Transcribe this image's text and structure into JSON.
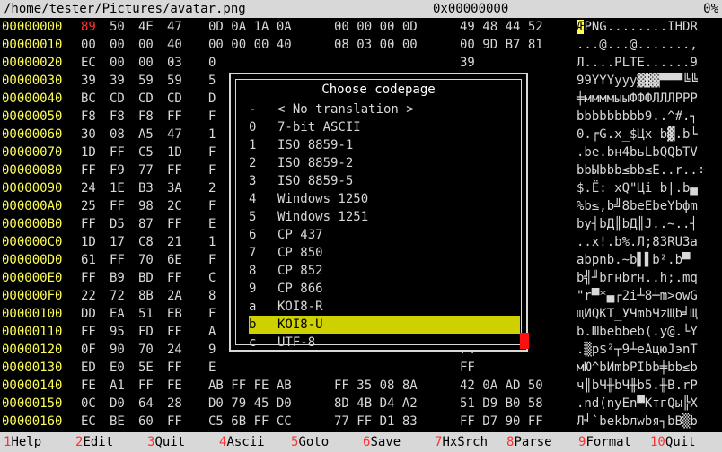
{
  "titlebar": {
    "path": "/home/tester/Pictures/avatar.png",
    "offset": "0x00000000",
    "percent": "0%"
  },
  "rows": [
    {
      "addr": "00000000",
      "g1": [
        "89",
        "50",
        "4E",
        "47"
      ],
      "g2": "0D 0A 1A 0A",
      "g3": "00 00 00 0D",
      "g4": "49 48 44 52",
      "ascii": "ÆPNG........IHDR"
    },
    {
      "addr": "00000010",
      "g1": [
        "00",
        "00",
        "00",
        "40"
      ],
      "g2": "00 00 00 40",
      "g3": "08 03 00 00",
      "g4": "00 9D B7 81",
      "ascii": "...@...@.......,"
    },
    {
      "addr": "00000020",
      "g1": [
        "EC",
        "00",
        "00",
        "03"
      ],
      "g2": "0",
      "g3": "",
      "g4": "39",
      "ascii": "Л....PLTE......9"
    },
    {
      "addr": "00000030",
      "g1": [
        "39",
        "39",
        "59",
        "59"
      ],
      "g2": "5",
      "g3": "",
      "g4": "BC",
      "ascii": "99YYYyyy▓▓▓▀▀▀╚╚"
    },
    {
      "addr": "00000040",
      "g1": [
        "BC",
        "CD",
        "CD",
        "CD"
      ],
      "g2": "D",
      "g3": "",
      "g4": "F2",
      "ascii": "╪ммммыыФФФЛЛЛРРР"
    },
    {
      "addr": "00000050",
      "g1": [
        "F8",
        "F8",
        "F8",
        "FF"
      ],
      "g2": "F",
      "g3": "",
      "g4": "83",
      "ascii": "bbbbbbbbb9..^#.┐"
    },
    {
      "addr": "00000060",
      "g1": [
        "30",
        "08",
        "A5",
        "47"
      ],
      "g2": "1",
      "g3": "",
      "g4": "AB",
      "ascii": "0.╒G.x_$Цx b▓.b└"
    },
    {
      "addr": "00000070",
      "g1": [
        "1D",
        "FF",
        "C5",
        "1D"
      ],
      "g2": "F",
      "g3": "",
      "g4": "56",
      "ascii": ".be.bн4bьLbQQbTV"
    },
    {
      "addr": "00000080",
      "g1": [
        "FF",
        "F9",
        "77",
        "FF"
      ],
      "g2": "F",
      "g3": "",
      "g4": "9F",
      "ascii": "bbЫbbb≤bb≤E..r..÷"
    },
    {
      "addr": "00000090",
      "g1": [
        "24",
        "1E",
        "B3",
        "3A"
      ],
      "g2": "2",
      "g3": "",
      "g4": "BC",
      "ascii": "$.Ё: xQ\"Цi b|.b▄"
    },
    {
      "addr": "000000A0",
      "g1": [
        "25",
        "FF",
        "98",
        "2C"
      ],
      "g2": "F",
      "g3": "",
      "g4": "6D",
      "ascii": "%b≤,b╝8beEbeYbфm"
    },
    {
      "addr": "000000B0",
      "g1": [
        "FF",
        "D5",
        "87",
        "FF"
      ],
      "g2": "E",
      "g3": "",
      "g4": "B2",
      "ascii": "bу┤bД║bД║J..~..┤"
    },
    {
      "addr": "000000C0",
      "g1": [
        "1D",
        "17",
        "C8",
        "21"
      ],
      "g2": "1",
      "g3": "",
      "g4": "61",
      "ascii": "..x!.b%.Л;83RU3a"
    },
    {
      "addr": "000000D0",
      "g1": [
        "61",
        "FF",
        "70",
        "6E"
      ],
      "g2": "F",
      "g3": "",
      "g4": "AD",
      "ascii": "abpnb.~b▌▌b².b▀"
    },
    {
      "addr": "000000E0",
      "g1": [
        "FF",
        "B9",
        "BD",
        "FF"
      ],
      "g2": "C",
      "g3": "",
      "g4": "71",
      "ascii": "b╣╜bгнbrн..h;.mq"
    },
    {
      "addr": "000000F0",
      "g1": [
        "22",
        "72",
        "8B",
        "2A"
      ],
      "g2": "8",
      "g3": "",
      "g4": "47",
      "ascii": "\"r▀*▄┌2i┴8┴m>owG"
    },
    {
      "addr": "00000100",
      "g1": [
        "DD",
        "EA",
        "51",
        "EB"
      ],
      "g2": "F",
      "g3": "",
      "g4": "FB",
      "ascii": "щИQKT_УЧmbЧzЩb╛Щ"
    },
    {
      "addr": "00000110",
      "g1": [
        "FF",
        "95",
        "FD",
        "FF"
      ],
      "g2": "A",
      "g3": "",
      "g4": "59",
      "ascii": "b.Шbebbeb(.y@.└Y"
    },
    {
      "addr": "00000120",
      "g1": [
        "0F",
        "90",
        "70",
        "24"
      ],
      "g2": "9",
      "g3": "",
      "g4": "74",
      "ascii": ".▒p$²┬9┴eAцюJэnT"
    },
    {
      "addr": "00000130",
      "g1": [
        "ED",
        "E0",
        "5E",
        "FF"
      ],
      "g2": "E",
      "g3": "",
      "g4": "FF",
      "ascii": "мЮ^bИmbPIbb╪bb≤b"
    },
    {
      "addr": "00000140",
      "g1": [
        "FE",
        "A1",
        "FF",
        "FE"
      ],
      "g2": "AB FF FE AB",
      "g3": "FF 35 08 8A",
      "g4": "42 0A AD 50",
      "ascii": "ч║bЧ╫bЧ╫b5.╫B.rP"
    },
    {
      "addr": "00000150",
      "g1": [
        "0C",
        "D0",
        "64",
        "28"
      ],
      "g2": "D0 79 45 D0",
      "g3": "8D 4B D4 A2",
      "g4": "51 D9 B0 58",
      "ascii": ".nd(nуEn▀KтгQы╠X"
    },
    {
      "addr": "00000160",
      "g1": [
        "EC",
        "BE",
        "60",
        "FF"
      ],
      "g2": "C5 6B FF CC",
      "g3": "77 FF D1 83",
      "g4": "FF D7 90 FF",
      "ascii": "Л╛`bekbлwbя┐bВ▒b"
    }
  ],
  "dialog": {
    "title": "Choose codepage",
    "options": [
      {
        "key": "-",
        "name": "< No translation >"
      },
      {
        "key": "0",
        "name": "7-bit ASCII"
      },
      {
        "key": "1",
        "name": "ISO 8859-1"
      },
      {
        "key": "2",
        "name": "ISO 8859-2"
      },
      {
        "key": "3",
        "name": "ISO 8859-5"
      },
      {
        "key": "4",
        "name": "Windows 1250"
      },
      {
        "key": "5",
        "name": "Windows 1251"
      },
      {
        "key": "6",
        "name": "CP 437"
      },
      {
        "key": "7",
        "name": "CP 850"
      },
      {
        "key": "8",
        "name": "CP 852"
      },
      {
        "key": "9",
        "name": "CP 866"
      },
      {
        "key": "a",
        "name": "KOI8-R"
      },
      {
        "key": "b",
        "name": "KOI8-U"
      },
      {
        "key": "c",
        "name": "UTF-8"
      }
    ],
    "selected_index": 12
  },
  "fkeys": [
    {
      "num": "1",
      "label": "Help"
    },
    {
      "num": "2",
      "label": "Edit"
    },
    {
      "num": "3",
      "label": "Quit"
    },
    {
      "num": "4",
      "label": "Ascii"
    },
    {
      "num": "5",
      "label": "Goto"
    },
    {
      "num": "6",
      "label": "Save"
    },
    {
      "num": "7",
      "label": "HxSrch"
    },
    {
      "num": "8",
      "label": "Parse"
    },
    {
      "num": "9",
      "label": "Format"
    },
    {
      "num": "10",
      "label": "Quit"
    }
  ],
  "colors": {
    "address": "#ffff55",
    "highlight": "#cfd000",
    "cursor": "#ff3030"
  }
}
